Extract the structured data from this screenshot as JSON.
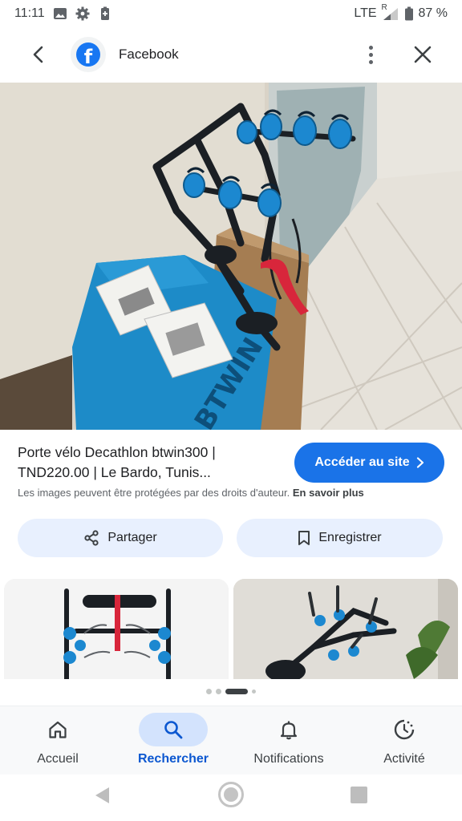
{
  "status_bar": {
    "time": "11:11",
    "network": "LTE",
    "roaming": "R",
    "battery": "87 %"
  },
  "header": {
    "source_name": "Facebook",
    "source_logo_letter": "f"
  },
  "result": {
    "title": "Porte vélo Decathlon btwin300 | TND220.00 | Le Bardo, Tunis...",
    "visit_label": "Accéder au site",
    "copyright_text": "Les images peuvent être protégées par des droits d'auteur.",
    "learn_more": "En savoir plus"
  },
  "actions": {
    "share_label": "Partager",
    "save_label": "Enregistrer"
  },
  "bottom_nav": {
    "items": [
      {
        "label": "Accueil",
        "icon": "home-icon"
      },
      {
        "label": "Rechercher",
        "icon": "search-icon",
        "active": true
      },
      {
        "label": "Notifications",
        "icon": "bell-icon"
      },
      {
        "label": "Activité",
        "icon": "activity-icon"
      }
    ]
  },
  "colors": {
    "accent": "#1a73e8",
    "chip_bg": "#e8f0fe",
    "nav_active_bg": "#d3e3fd",
    "nav_active_text": "#0b57d0"
  }
}
